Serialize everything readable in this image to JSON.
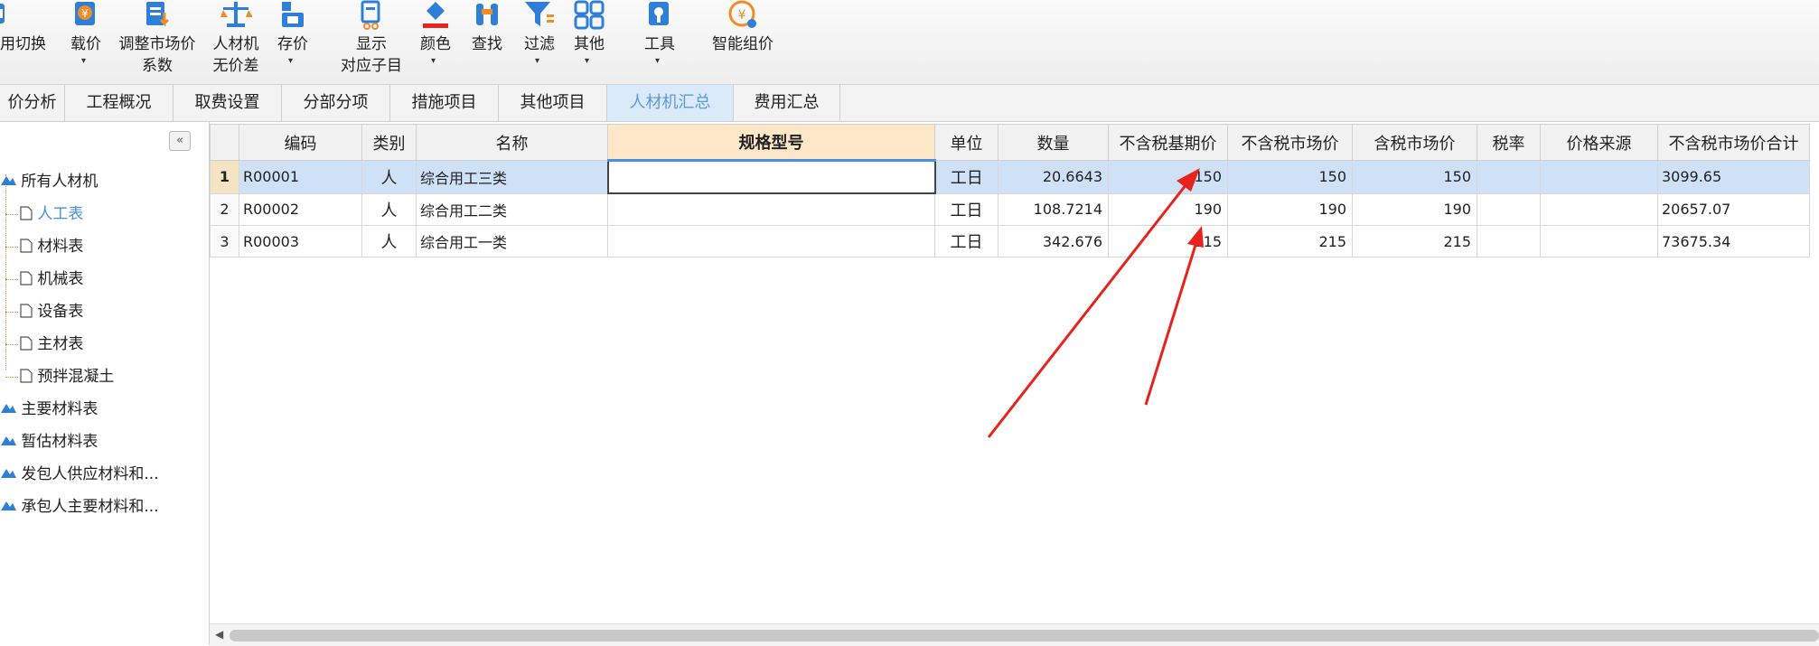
{
  "toolbar": {
    "buttons": [
      {
        "l1": "用切换",
        "l2": "",
        "icon": "switch-icon"
      },
      {
        "l1": "载价",
        "l2": "",
        "icon": "load-price-icon",
        "caret": true
      },
      {
        "l1": "调整市场价",
        "l2": "系数",
        "icon": "adjust-market-price-icon"
      },
      {
        "l1": "人材机",
        "l2": "无价差",
        "icon": "scale-icon"
      },
      {
        "l1": "存价",
        "l2": "",
        "icon": "save-price-icon",
        "caret": true
      },
      {
        "l1": "显示",
        "l2": "对应子目",
        "icon": "show-sub-item-icon"
      },
      {
        "l1": "颜色",
        "l2": "",
        "icon": "paint-bucket-icon",
        "caret": true
      },
      {
        "l1": "查找",
        "l2": "",
        "icon": "binoculars-icon"
      },
      {
        "l1": "过滤",
        "l2": "",
        "icon": "filter-icon",
        "caret": true
      },
      {
        "l1": "其他",
        "l2": "",
        "icon": "grid-apps-icon",
        "caret": true
      },
      {
        "l1": "工具",
        "l2": "",
        "icon": "tools-icon",
        "caret": true
      },
      {
        "l1": "智能组价",
        "l2": "",
        "icon": "smart-pricing-icon"
      }
    ]
  },
  "tabs": [
    "价分析",
    "工程概况",
    "取费设置",
    "分部分项",
    "措施项目",
    "其他项目",
    "人材机汇总",
    "费用汇总"
  ],
  "active_tab": "人材机汇总",
  "sidebar": {
    "collapse_glyph": "«",
    "root": "所有人材机",
    "children": [
      "人工表",
      "材料表",
      "机械表",
      "设备表",
      "主材表",
      "预拌混凝土"
    ],
    "selected": "人工表",
    "others": [
      "主要材料表",
      "暂估材料表",
      "发包人供应材料和...",
      "承包人主要材料和..."
    ]
  },
  "grid": {
    "headers": [
      "编码",
      "类别",
      "名称",
      "规格型号",
      "单位",
      "数量",
      "不含税基期价",
      "不含税市场价",
      "含税市场价",
      "税率",
      "价格来源",
      "不含税市场价合计"
    ],
    "rows": [
      {
        "no": "1",
        "code": "R00001",
        "cat": "人",
        "name": "综合用工三类",
        "spec": "",
        "unit": "工日",
        "qty": "20.6643",
        "base": "150",
        "market": "150",
        "taxed": "150",
        "rate": "",
        "source": "",
        "total": "3099.65"
      },
      {
        "no": "2",
        "code": "R00002",
        "cat": "人",
        "name": "综合用工二类",
        "spec": "",
        "unit": "工日",
        "qty": "108.7214",
        "base": "190",
        "market": "190",
        "taxed": "190",
        "rate": "",
        "source": "",
        "total": "20657.07"
      },
      {
        "no": "3",
        "code": "R00003",
        "cat": "人",
        "name": "综合用工一类",
        "spec": "",
        "unit": "工日",
        "qty": "342.676",
        "base": "215",
        "market": "215",
        "taxed": "215",
        "rate": "",
        "source": "",
        "total": "73675.34"
      }
    ],
    "selected_row": "1"
  },
  "colors": {
    "accent": "#4a90e2",
    "selected_row": "#cfe1f7",
    "annotation_arrow": "#e8231b",
    "icon_blue": "#2f7fd8",
    "icon_orange": "#f28c28"
  }
}
